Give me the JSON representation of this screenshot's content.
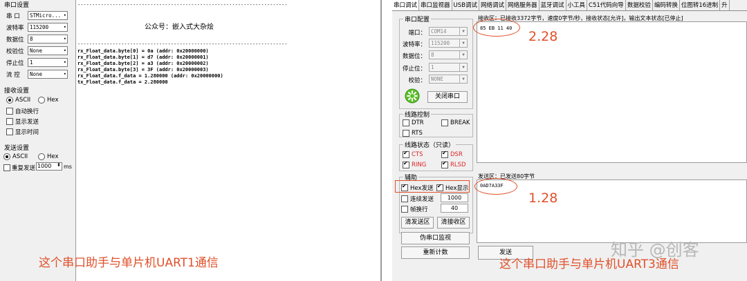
{
  "left": {
    "serial_settings_title": "串口设置",
    "rows": [
      {
        "label": "串  口",
        "value": "STMicro..."
      },
      {
        "label": "波特率",
        "value": "115200"
      },
      {
        "label": "数据位",
        "value": "8"
      },
      {
        "label": "校验位",
        "value": "None"
      },
      {
        "label": "停止位",
        "value": "1"
      },
      {
        "label": "流  控",
        "value": "None"
      }
    ],
    "recv_title": "接收设置",
    "recv_ascii": "ASCII",
    "recv_hex": "Hex",
    "auto_wrap": "自动换行",
    "show_send": "显示发送",
    "show_time": "显示时间",
    "send_title": "发送设置",
    "send_ascii": "ASCII",
    "send_hex": "Hex",
    "repeat_send": "重复发送",
    "repeat_value": "1000",
    "repeat_unit": "ms",
    "text": {
      "divider": "------------------------------------------------------------------------",
      "heading": "公众号：嵌入式大杂烩",
      "lines": [
        "rx_Float_data.byte[0] = 0a (addr: 0x20000000)",
        "rx_Float_data.byte[1] = d7 (addr: 0x20000001)",
        "rx_Float_data.byte[2] = a3 (addr: 0x20000002)",
        "rx_Float_data.byte[3] = 3F (addr: 0x20000003)",
        "rx_Float_data.f_data = 1.280000 (addr: 0x20000000)",
        "tx_Float_data.f_data = 2.280000"
      ]
    },
    "caption": "这个串口助手与单片机UART1通信"
  },
  "right": {
    "tabs": [
      "串口调试",
      "串口监视器",
      "USB调试",
      "网络调试",
      "网络服务器",
      "蓝牙调试",
      "小工具",
      "C51代码向导",
      "数据校验",
      "编码转换",
      "位图转16进制",
      "升"
    ],
    "config_title": "串口配置",
    "port_label": "端口：",
    "port_value": "COM14",
    "baud_label": "波特率：",
    "baud_value": "115200",
    "data_label": "数据位：",
    "data_value": "8",
    "stop_label": "停止位：",
    "stop_value": "1",
    "parity_label": "校验：",
    "parity_value": "NONE",
    "close_button": "关闭串口",
    "line_ctrl_title": "线路控制",
    "dtr": "DTR",
    "break": "BREAK",
    "rts": "RTS",
    "line_state_title": "线路状态（只读）",
    "cts": "CTS",
    "dsr": "DSR",
    "ring": "RING",
    "rlsd": "RLSD",
    "assist_title": "辅助",
    "hex_send": "Hex发送",
    "hex_show": "Hex显示",
    "cont_send": "连续发送",
    "cont_value": "1000",
    "frame_wrap": "帧换行",
    "frame_value": "40",
    "clear_send": "清发送区",
    "clear_recv": "清接收区",
    "fake_monitor": "伪串口监视",
    "reset_count": "重新计数",
    "recv_title": "接收区：已接收3372字节，速度0字节/秒，接收状态[允许]，输出文本状态[已停止]",
    "recv_data": "85 EB 11 40",
    "recv_anno": "2.28",
    "send_title": "发送区：已发送80字节",
    "send_data": "0AD7A33F",
    "send_anno": "1.28",
    "send_button": "发送",
    "caption": "这个串口助手与单片机UART3通信",
    "watermark": "知乎 @创客"
  },
  "colors": {
    "annotation": "#e0502a",
    "red_label": "#dd2222"
  },
  "icons": {
    "open_close_icon": "green-gear-icon",
    "dropdown": "chevron-down-icon"
  }
}
